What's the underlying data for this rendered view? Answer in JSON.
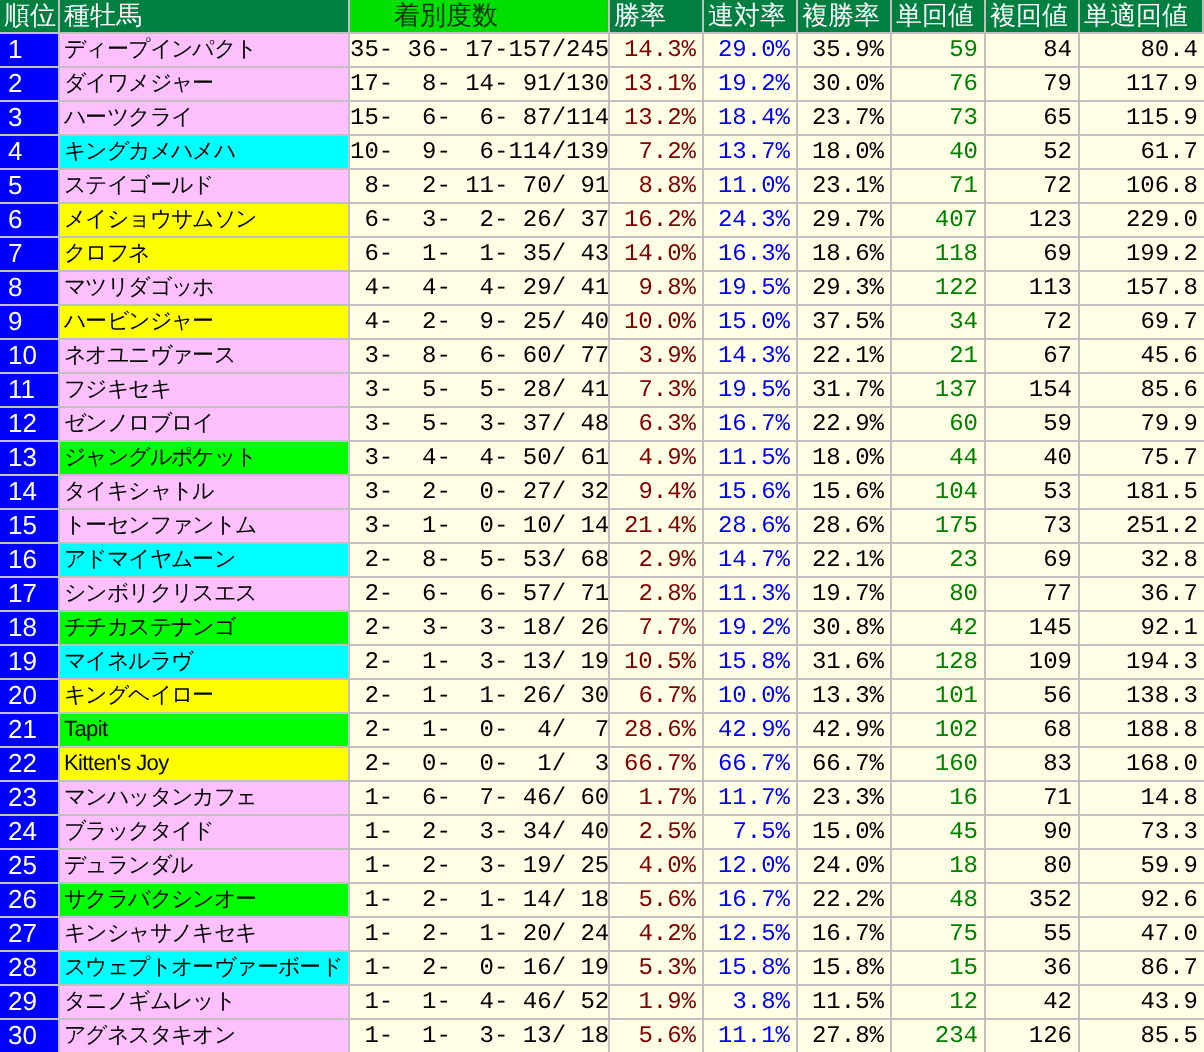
{
  "columns": [
    {
      "label": "順位",
      "kind": "dark"
    },
    {
      "label": "種牡馬",
      "kind": "dark"
    },
    {
      "label": "着別度数",
      "kind": "bright"
    },
    {
      "label": "勝率",
      "kind": "dark"
    },
    {
      "label": "連対率",
      "kind": "dark"
    },
    {
      "label": "複勝率",
      "kind": "dark"
    },
    {
      "label": "単回値",
      "kind": "dark"
    },
    {
      "label": "複回値",
      "kind": "dark"
    },
    {
      "label": "単適回値",
      "kind": "dark"
    }
  ],
  "rows": [
    {
      "rank": "1",
      "name": "ディープインパクト",
      "color": "#ffc0ff",
      "record": "35- 36- 17-157/245",
      "win": "14.3%",
      "top2": "29.0%",
      "top3": "35.9%",
      "win_return": "59",
      "place_return": "84",
      "adj_return": "80.4"
    },
    {
      "rank": "2",
      "name": "ダイワメジャー",
      "color": "#ffc0ff",
      "record": "17-  8- 14- 91/130",
      "win": "13.1%",
      "top2": "19.2%",
      "top3": "30.0%",
      "win_return": "76",
      "place_return": "79",
      "adj_return": "117.9"
    },
    {
      "rank": "3",
      "name": "ハーツクライ",
      "color": "#ffc0ff",
      "record": "15-  6-  6- 87/114",
      "win": "13.2%",
      "top2": "18.4%",
      "top3": "23.7%",
      "win_return": "73",
      "place_return": "65",
      "adj_return": "115.9"
    },
    {
      "rank": "4",
      "name": "キングカメハメハ",
      "color": "#00ffff",
      "record": "10-  9-  6-114/139",
      "win": "7.2%",
      "top2": "13.7%",
      "top3": "18.0%",
      "win_return": "40",
      "place_return": "52",
      "adj_return": "61.7"
    },
    {
      "rank": "5",
      "name": "ステイゴールド",
      "color": "#ffc0ff",
      "record": " 8-  2- 11- 70/ 91",
      "win": "8.8%",
      "top2": "11.0%",
      "top3": "23.1%",
      "win_return": "71",
      "place_return": "72",
      "adj_return": "106.8"
    },
    {
      "rank": "6",
      "name": "メイショウサムソン",
      "color": "#ffff00",
      "record": " 6-  3-  2- 26/ 37",
      "win": "16.2%",
      "top2": "24.3%",
      "top3": "29.7%",
      "win_return": "407",
      "place_return": "123",
      "adj_return": "229.0"
    },
    {
      "rank": "7",
      "name": "クロフネ",
      "color": "#ffff00",
      "record": " 6-  1-  1- 35/ 43",
      "win": "14.0%",
      "top2": "16.3%",
      "top3": "18.6%",
      "win_return": "118",
      "place_return": "69",
      "adj_return": "199.2"
    },
    {
      "rank": "8",
      "name": "マツリダゴッホ",
      "color": "#ffc0ff",
      "record": " 4-  4-  4- 29/ 41",
      "win": "9.8%",
      "top2": "19.5%",
      "top3": "29.3%",
      "win_return": "122",
      "place_return": "113",
      "adj_return": "157.8"
    },
    {
      "rank": "9",
      "name": "ハービンジャー",
      "color": "#ffff00",
      "record": " 4-  2-  9- 25/ 40",
      "win": "10.0%",
      "top2": "15.0%",
      "top3": "37.5%",
      "win_return": "34",
      "place_return": "72",
      "adj_return": "69.7"
    },
    {
      "rank": "10",
      "name": "ネオユニヴァース",
      "color": "#ffc0ff",
      "record": " 3-  8-  6- 60/ 77",
      "win": "3.9%",
      "top2": "14.3%",
      "top3": "22.1%",
      "win_return": "21",
      "place_return": "67",
      "adj_return": "45.6"
    },
    {
      "rank": "11",
      "name": "フジキセキ",
      "color": "#ffc0ff",
      "record": " 3-  5-  5- 28/ 41",
      "win": "7.3%",
      "top2": "19.5%",
      "top3": "31.7%",
      "win_return": "137",
      "place_return": "154",
      "adj_return": "85.6"
    },
    {
      "rank": "12",
      "name": "ゼンノロブロイ",
      "color": "#ffc0ff",
      "record": " 3-  5-  3- 37/ 48",
      "win": "6.3%",
      "top2": "16.7%",
      "top3": "22.9%",
      "win_return": "60",
      "place_return": "59",
      "adj_return": "79.9"
    },
    {
      "rank": "13",
      "name": "ジャングルポケット",
      "color": "#00ff00",
      "record": " 3-  4-  4- 50/ 61",
      "win": "4.9%",
      "top2": "11.5%",
      "top3": "18.0%",
      "win_return": "44",
      "place_return": "40",
      "adj_return": "75.7"
    },
    {
      "rank": "14",
      "name": "タイキシャトル",
      "color": "#ffc0ff",
      "record": " 3-  2-  0- 27/ 32",
      "win": "9.4%",
      "top2": "15.6%",
      "top3": "15.6%",
      "win_return": "104",
      "place_return": "53",
      "adj_return": "181.5"
    },
    {
      "rank": "15",
      "name": "トーセンファントム",
      "color": "#ffc0ff",
      "record": " 3-  1-  0- 10/ 14",
      "win": "21.4%",
      "top2": "28.6%",
      "top3": "28.6%",
      "win_return": "175",
      "place_return": "73",
      "adj_return": "251.2"
    },
    {
      "rank": "16",
      "name": "アドマイヤムーン",
      "color": "#00ffff",
      "record": " 2-  8-  5- 53/ 68",
      "win": "2.9%",
      "top2": "14.7%",
      "top3": "22.1%",
      "win_return": "23",
      "place_return": "69",
      "adj_return": "32.8"
    },
    {
      "rank": "17",
      "name": "シンボリクリスエス",
      "color": "#ffc0ff",
      "record": " 2-  6-  6- 57/ 71",
      "win": "2.8%",
      "top2": "11.3%",
      "top3": "19.7%",
      "win_return": "80",
      "place_return": "77",
      "adj_return": "36.7"
    },
    {
      "rank": "18",
      "name": "チチカステナンゴ",
      "color": "#00ff00",
      "record": " 2-  3-  3- 18/ 26",
      "win": "7.7%",
      "top2": "19.2%",
      "top3": "30.8%",
      "win_return": "42",
      "place_return": "145",
      "adj_return": "92.1"
    },
    {
      "rank": "19",
      "name": "マイネルラヴ",
      "color": "#00ffff",
      "record": " 2-  1-  3- 13/ 19",
      "win": "10.5%",
      "top2": "15.8%",
      "top3": "31.6%",
      "win_return": "128",
      "place_return": "109",
      "adj_return": "194.3"
    },
    {
      "rank": "20",
      "name": "キングヘイロー",
      "color": "#ffff00",
      "record": " 2-  1-  1- 26/ 30",
      "win": "6.7%",
      "top2": "10.0%",
      "top3": "13.3%",
      "win_return": "101",
      "place_return": "56",
      "adj_return": "138.3"
    },
    {
      "rank": "21",
      "name": "Tapit",
      "color": "#00ff00",
      "record": " 2-  1-  0-  4/  7",
      "win": "28.6%",
      "top2": "42.9%",
      "top3": "42.9%",
      "win_return": "102",
      "place_return": "68",
      "adj_return": "188.8"
    },
    {
      "rank": "22",
      "name": "Kitten's Joy",
      "color": "#ffff00",
      "record": " 2-  0-  0-  1/  3",
      "win": "66.7%",
      "top2": "66.7%",
      "top3": "66.7%",
      "win_return": "160",
      "place_return": "83",
      "adj_return": "168.0"
    },
    {
      "rank": "23",
      "name": "マンハッタンカフェ",
      "color": "#ffc0ff",
      "record": " 1-  6-  7- 46/ 60",
      "win": "1.7%",
      "top2": "11.7%",
      "top3": "23.3%",
      "win_return": "16",
      "place_return": "71",
      "adj_return": "14.8"
    },
    {
      "rank": "24",
      "name": "ブラックタイド",
      "color": "#ffc0ff",
      "record": " 1-  2-  3- 34/ 40",
      "win": "2.5%",
      "top2": "7.5%",
      "top3": "15.0%",
      "win_return": "45",
      "place_return": "90",
      "adj_return": "73.3"
    },
    {
      "rank": "25",
      "name": "デュランダル",
      "color": "#ffc0ff",
      "record": " 1-  2-  3- 19/ 25",
      "win": "4.0%",
      "top2": "12.0%",
      "top3": "24.0%",
      "win_return": "18",
      "place_return": "80",
      "adj_return": "59.9"
    },
    {
      "rank": "26",
      "name": "サクラバクシンオー",
      "color": "#00ff00",
      "record": " 1-  2-  1- 14/ 18",
      "win": "5.6%",
      "top2": "16.7%",
      "top3": "22.2%",
      "win_return": "48",
      "place_return": "352",
      "adj_return": "92.6"
    },
    {
      "rank": "27",
      "name": "キンシャサノキセキ",
      "color": "#ffc0ff",
      "record": " 1-  2-  1- 20/ 24",
      "win": "4.2%",
      "top2": "12.5%",
      "top3": "16.7%",
      "win_return": "75",
      "place_return": "55",
      "adj_return": "47.0"
    },
    {
      "rank": "28",
      "name": "スウェプトオーヴァーボード",
      "color": "#00ffff",
      "record": " 1-  2-  0- 16/ 19",
      "win": "5.3%",
      "top2": "15.8%",
      "top3": "15.8%",
      "win_return": "15",
      "place_return": "36",
      "adj_return": "86.7"
    },
    {
      "rank": "29",
      "name": "タニノギムレット",
      "color": "#ffc0ff",
      "record": " 1-  1-  4- 46/ 52",
      "win": "1.9%",
      "top2": "3.8%",
      "top3": "11.5%",
      "win_return": "12",
      "place_return": "42",
      "adj_return": "43.9"
    },
    {
      "rank": "30",
      "name": "アグネスタキオン",
      "color": "#ffc0ff",
      "record": " 1-  1-  3- 13/ 18",
      "win": "5.6%",
      "top2": "11.1%",
      "top3": "27.8%",
      "win_return": "234",
      "place_return": "126",
      "adj_return": "85.5"
    }
  ]
}
